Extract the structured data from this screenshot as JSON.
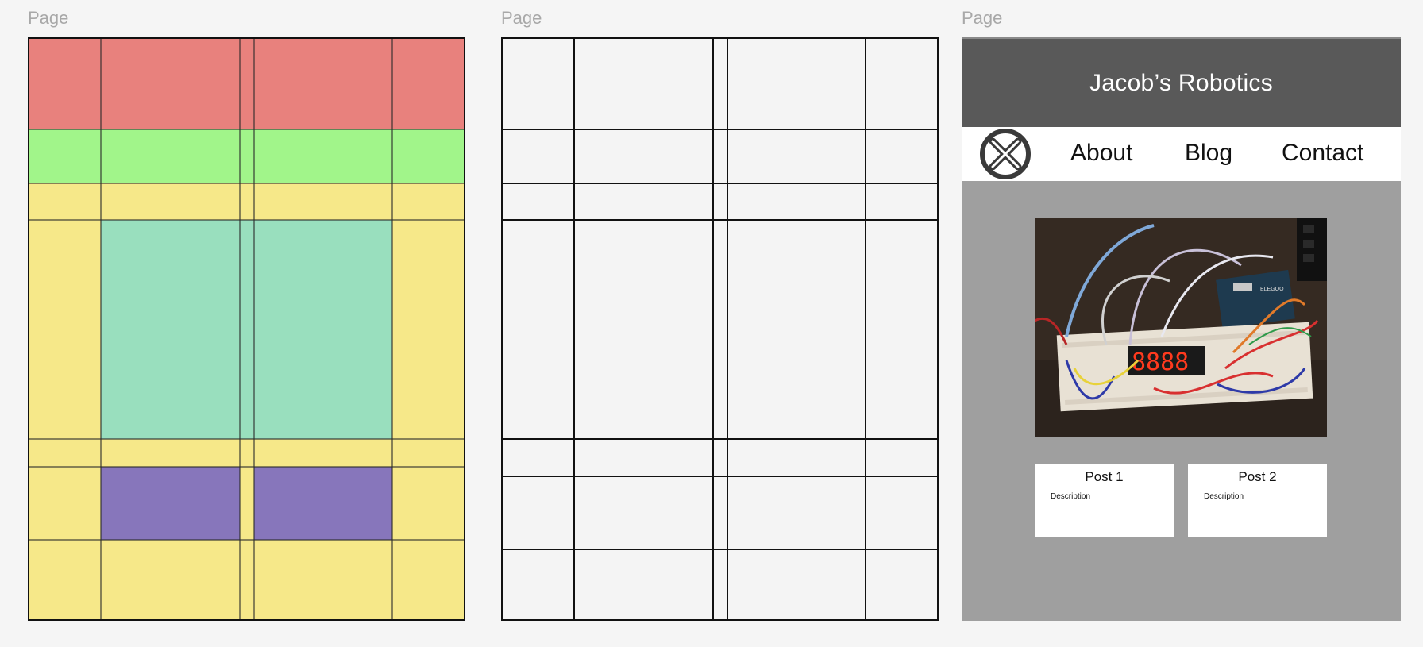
{
  "frames": [
    {
      "label": "Page",
      "kind": "colored-grid"
    },
    {
      "label": "Page",
      "kind": "blank-grid"
    },
    {
      "label": "Page",
      "kind": "mockup"
    }
  ],
  "colors": {
    "header_band": "#e8817d",
    "nav_band": "#a1f58a",
    "background_band": "#f6e889",
    "hero_area": "#99dfbe",
    "post_cards": "#8776bb",
    "mock_header": "#595959",
    "mock_background": "#9f9f9f"
  },
  "mockup": {
    "site_title": "Jacob’s Robotics",
    "logo_icon": "circle-x-logo-icon",
    "nav": [
      {
        "label": "About"
      },
      {
        "label": "Blog"
      },
      {
        "label": "Contact"
      }
    ],
    "hero_image": "breadboard-arduino-photo",
    "posts": [
      {
        "title": "Post 1",
        "description": "Description"
      },
      {
        "title": "Post 2",
        "description": "Description"
      }
    ]
  }
}
